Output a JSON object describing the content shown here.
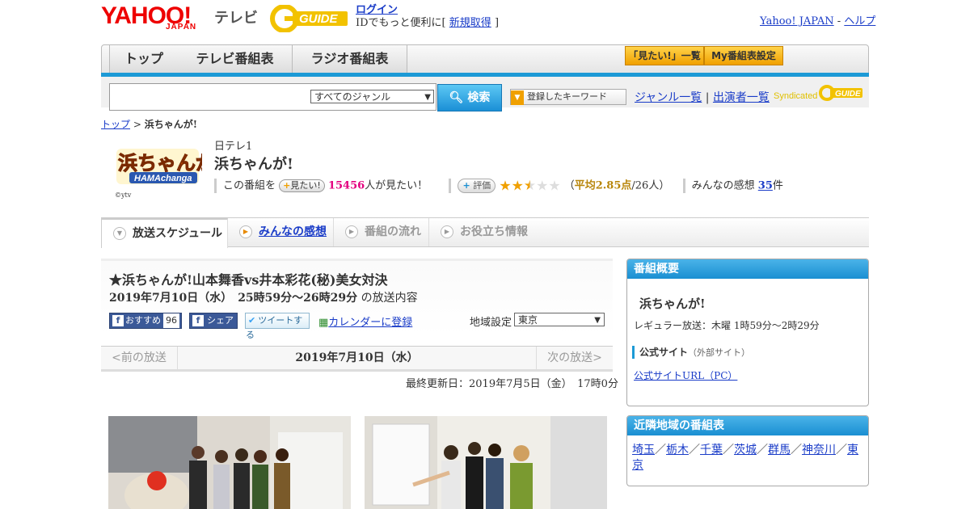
{
  "header": {
    "yahoo_logo": "YAHOO!",
    "yahoo_sub": "JAPAN",
    "tv_label": "テレビ",
    "gguide_logo": "GUIDE",
    "login_link": "ログイン",
    "login_text": "IDでもっと便利に[",
    "signup_link": "新規取得",
    "login_text_end": "]",
    "yahoo_japan_link": "Yahoo! JAPAN",
    "separator": "-",
    "help_link": "ヘルプ"
  },
  "nav": {
    "tabs": [
      {
        "label": "トップ"
      },
      {
        "label": "テレビ番組表"
      },
      {
        "label": "ラジオ番組表"
      }
    ],
    "mitai_list": "「見たい!」一覧",
    "my_schedule": "My番組表設定"
  },
  "search": {
    "genre_selected": "すべてのジャンル",
    "button_label": "検索",
    "keyword_button": "登録したキーワード",
    "genre_list_link": "ジャンル一覧",
    "link_separator": "|",
    "cast_list_link": "出演者一覧",
    "syndicated": "Syndicated"
  },
  "breadcrumb": {
    "top": "トップ",
    "sep": ">",
    "current": "浜ちゃんが!"
  },
  "program": {
    "logo_text": "浜ちゃんが!",
    "logo_sub": "HAMAchanga",
    "copyright": "©ytv",
    "channel": "日テレ1",
    "title": "浜ちゃんが!",
    "this_program": "この番組を",
    "mitai_btn": "見たい!",
    "mitai_count": "15456",
    "mitai_suffix": "人が見たい！",
    "hyoka_btn": "評価",
    "rating": 2.85,
    "rating_paren_open": "（",
    "rating_avg": "平均2.85点",
    "rating_count": "/26人）",
    "impressions_label": "みんなの感想",
    "impressions_count": "35",
    "impressions_suffix": "件"
  },
  "subtabs": [
    {
      "label": "放送スケジュール",
      "state": "active"
    },
    {
      "label": "みんなの感想",
      "state": "link"
    },
    {
      "label": "番組の流れ",
      "state": "disabled"
    },
    {
      "label": "お役立ち情報",
      "state": "disabled"
    }
  ],
  "episode": {
    "title": "★浜ちゃんが!山本舞香vs井本彩花(秘)美女対決",
    "date_bold": "2019年7月10日（水）　25時59分～26時29分",
    "date_suffix": "の放送内容",
    "fb_recommend": "おすすめ",
    "fb_count": "96",
    "fb_share": "シェア",
    "tweet": "ツイートする",
    "calendar": "カレンダーに登録",
    "area_label": "地域設定",
    "area_selected": "東京",
    "prev": "<前の放送",
    "current_date": "2019年7月10日（水）",
    "next": "次の放送>",
    "updated": "最終更新日：2019年7月5日（金）　17時0分"
  },
  "sidebar": {
    "overview_title": "番組概要",
    "overview_name": "浜ちゃんが!",
    "regular": "レギュラー放送：木曜 1時59分～2時29分",
    "official_site": "公式サイト",
    "official_note": "（外部サイト）",
    "official_url": "公式サイトURL（PC）",
    "nearby_title": "近隣地域の番組表",
    "nearby_links": [
      "埼玉",
      "栃木",
      "千葉",
      "茨城",
      "群馬",
      "神奈川",
      "東京"
    ],
    "nearby_sep": "／"
  },
  "colors": {
    "accent_blue": "#1c9ad6",
    "yahoo_red": "#ee0000",
    "pink": "#e4007f",
    "star": "#f0a000"
  }
}
